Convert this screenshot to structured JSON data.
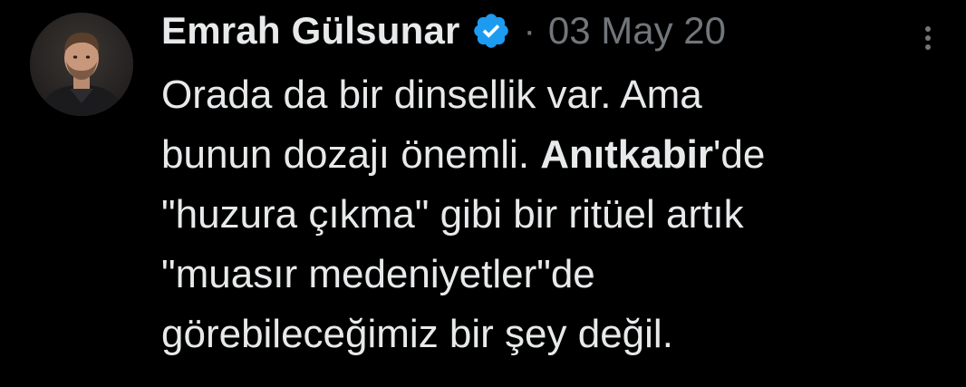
{
  "author": {
    "name": "Emrah Gülsunar",
    "verified": true,
    "avatar_icon": "profile-photo"
  },
  "meta": {
    "separator": "·",
    "date": "03 May 20"
  },
  "more_icon": "more-options-icon",
  "colors": {
    "background": "#000000",
    "text": "#e7e9ea",
    "muted": "#71767b",
    "verified_badge": "#1d9bf0"
  },
  "tweet": {
    "line1": "Orada da bir dinsellik var. Ama",
    "line2_a": "bunun dozajı önemli. ",
    "line2_bold": "Anıtkabir",
    "line2_b": "'de",
    "line3": "\"huzura çıkma\" gibi bir ritüel artık",
    "line4": "\"muasır medeniyetler\"de",
    "line5": "görebileceğimiz bir şey değil."
  }
}
